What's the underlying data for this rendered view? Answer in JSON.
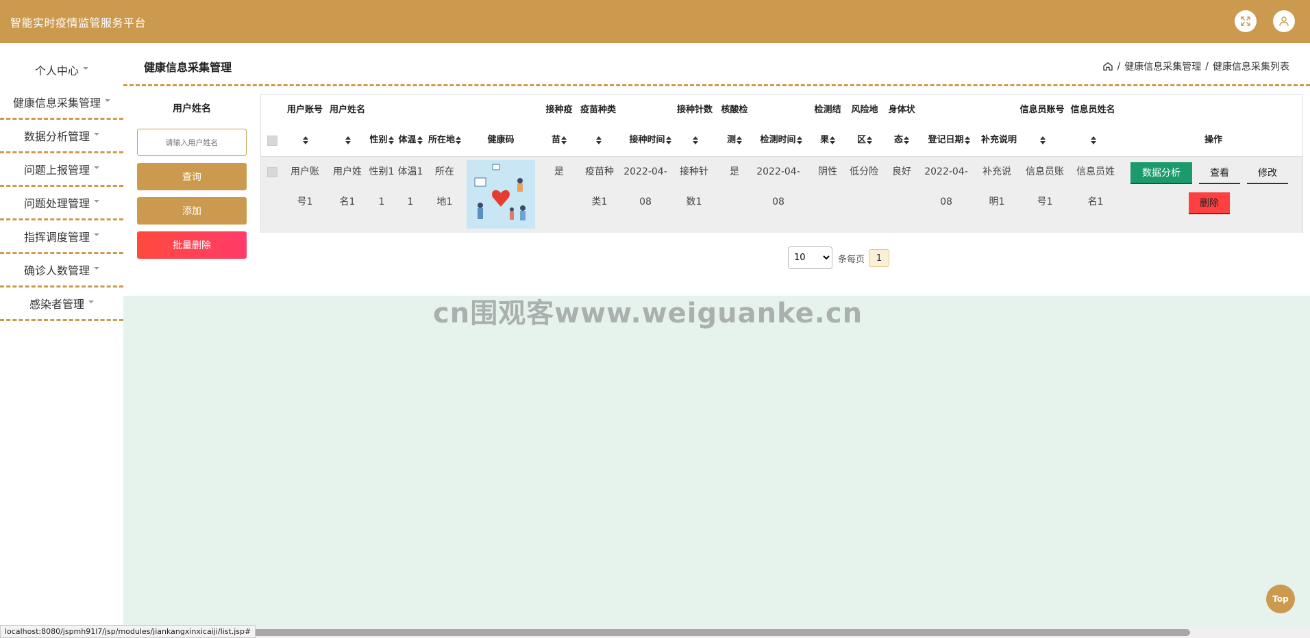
{
  "app": {
    "title": "智能实时疫情监管服务平台"
  },
  "header_icons": [
    "fullscreen-icon",
    "user-icon"
  ],
  "sidebar": {
    "items": [
      {
        "label": "个人中心"
      },
      {
        "label": "健康信息采集管理"
      },
      {
        "label": "数据分析管理"
      },
      {
        "label": "问题上报管理"
      },
      {
        "label": "问题处理管理"
      },
      {
        "label": "指挥调度管理"
      },
      {
        "label": "确诊人数管理"
      },
      {
        "label": "感染者管理"
      }
    ]
  },
  "page": {
    "title": "健康信息采集管理",
    "breadcrumb": [
      "健康信息采集管理",
      "健康信息采集列表"
    ]
  },
  "filter": {
    "label": "用户姓名",
    "placeholder": "请输入用户姓名",
    "search_button": "查询",
    "add_button": "添加",
    "batch_delete_button": "批量删除"
  },
  "table": {
    "headers": {
      "account_top": "用户账号",
      "name_top": "用户姓名",
      "gender": "性别",
      "temperature": "体温",
      "location": "所在地",
      "health_code": "健康码",
      "vaccinated_top": "接种疫",
      "vaccinated_bottom": "苗",
      "vaccine_type_top": "疫苗种类",
      "vaccination_time": "接种时间",
      "doses_top": "接种针数",
      "nucleic_top": "核酸检",
      "nucleic_bottom": "测",
      "test_time": "检测时间",
      "result_top": "检测结",
      "result_bottom": "果",
      "risk_top": "风险地",
      "risk_bottom": "区",
      "physical_top": "身体状",
      "physical_bottom": "态",
      "reg_date": "登记日期",
      "notes": "补充说明",
      "staff_account_top": "信息员账号",
      "staff_name_top": "信息员姓名",
      "actions": "操作"
    },
    "rows": [
      {
        "account": [
          "用户账",
          "号1"
        ],
        "name": [
          "用户姓",
          "名1"
        ],
        "gender": "性别1",
        "temperature": "体温1",
        "location": [
          "所在",
          "地1"
        ],
        "vaccinated": "是",
        "vaccine_type": [
          "疫苗种",
          "类1"
        ],
        "vaccination_time": [
          "2022-04-",
          "08"
        ],
        "doses": [
          "接种针",
          "数1"
        ],
        "nucleic": "是",
        "test_time": [
          "2022-04-",
          "08"
        ],
        "result": "阴性",
        "risk": "低分险",
        "physical": "良好",
        "reg_date": [
          "2022-04-",
          "08"
        ],
        "notes": [
          "补充说",
          "明1"
        ],
        "staff_account": [
          "信息员账",
          "号1"
        ],
        "staff_name": [
          "信息员姓",
          "名1"
        ],
        "actions": {
          "analyze": "数据分析",
          "view": "查看",
          "edit": "修改",
          "delete": "删除"
        }
      }
    ]
  },
  "pagination": {
    "page_size": "10",
    "page_size_label": "条每页",
    "current_page": "1"
  },
  "watermark": "cn围观客www.weiguanke.cn",
  "top_button": "Top",
  "status_url": "localhost:8080/jspmh91l7/jsp/modules/jiankangxinxicaiji/list.jsp#",
  "colors": {
    "primary": "#cc9a4e",
    "danger": "#ff4a3d",
    "success": "#1b9a6c",
    "content_bg": "#e6f3ed"
  }
}
